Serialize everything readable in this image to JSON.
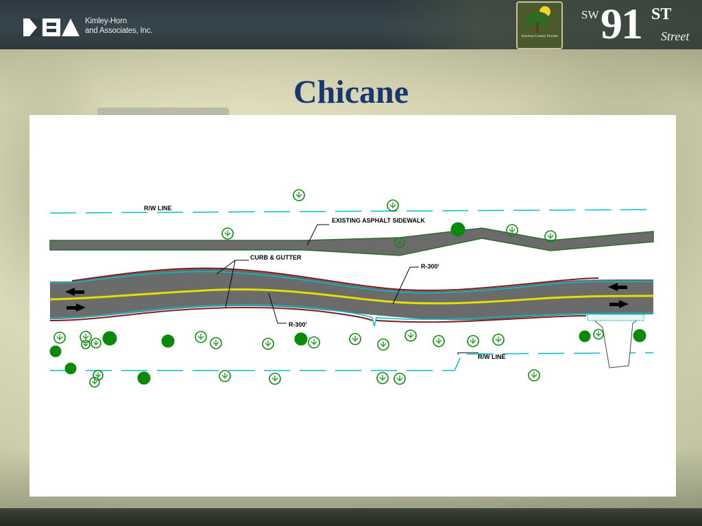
{
  "header": {
    "company_line1": "Kimley-Horn",
    "company_line2": "and Associates, Inc.",
    "seal_text": "Alachua County Florida",
    "brand_sw": "SW",
    "brand_number": "91",
    "brand_suffix": "ST",
    "brand_street": "Street"
  },
  "slide": {
    "title": "Chicane"
  },
  "diagram": {
    "labels": {
      "rw_line_top": "R/W LINE",
      "sidewalk": "EXISTING ASPHALT SIDEWALK",
      "curb_gutter": "CURB & GUTTER",
      "radius_top": "R-300'",
      "radius_bottom": "R-300'",
      "rw_line_bottom": "R/W LINE"
    },
    "colors": {
      "row_line": "#00bfc8",
      "pavement": "#6b6b6b",
      "centerline": "#e3e000",
      "curb": "#7a1d1d",
      "tree": "#0a8a0a"
    }
  }
}
